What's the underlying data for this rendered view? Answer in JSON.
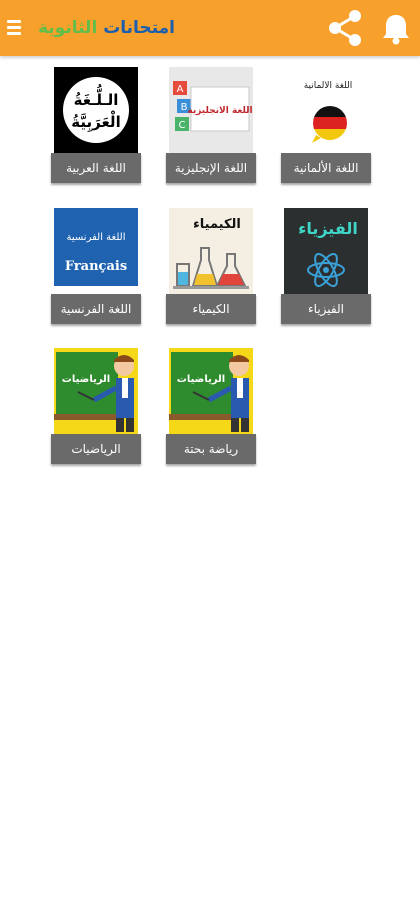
{
  "header": {
    "title_part1": "امتحانات",
    "title_part2": "الثانوية",
    "icons": [
      "bell-icon",
      "share-icon",
      "menu-icon"
    ],
    "colors": {
      "bar": "#f7a02c",
      "title_part1": "#1b5fae",
      "title_part2": "#5fbf4a"
    }
  },
  "subjects": [
    {
      "label": "اللغة العربية",
      "thumb_text": [
        "الـلُّـغَةُ",
        "الْعَرَبِيَّةُ"
      ]
    },
    {
      "label": "اللغة الإنجليزية",
      "thumb_text": "اللغة الانجليزية"
    },
    {
      "label": "اللغة الألمانية",
      "thumb_text": "اللغة الالمانية"
    },
    {
      "label": "اللغة الفرنسية",
      "thumb_text": [
        "اللغة الفرنسية",
        "Français"
      ]
    },
    {
      "label": "الكيمياء",
      "thumb_text": "الكيمياء"
    },
    {
      "label": "الفيزياء",
      "thumb_text": "الفيزياء"
    },
    {
      "label": "الرياضيات",
      "thumb_text": "الرياضيات"
    },
    {
      "label": "رياضة بحتة",
      "thumb_text": "الرياضيات"
    }
  ]
}
